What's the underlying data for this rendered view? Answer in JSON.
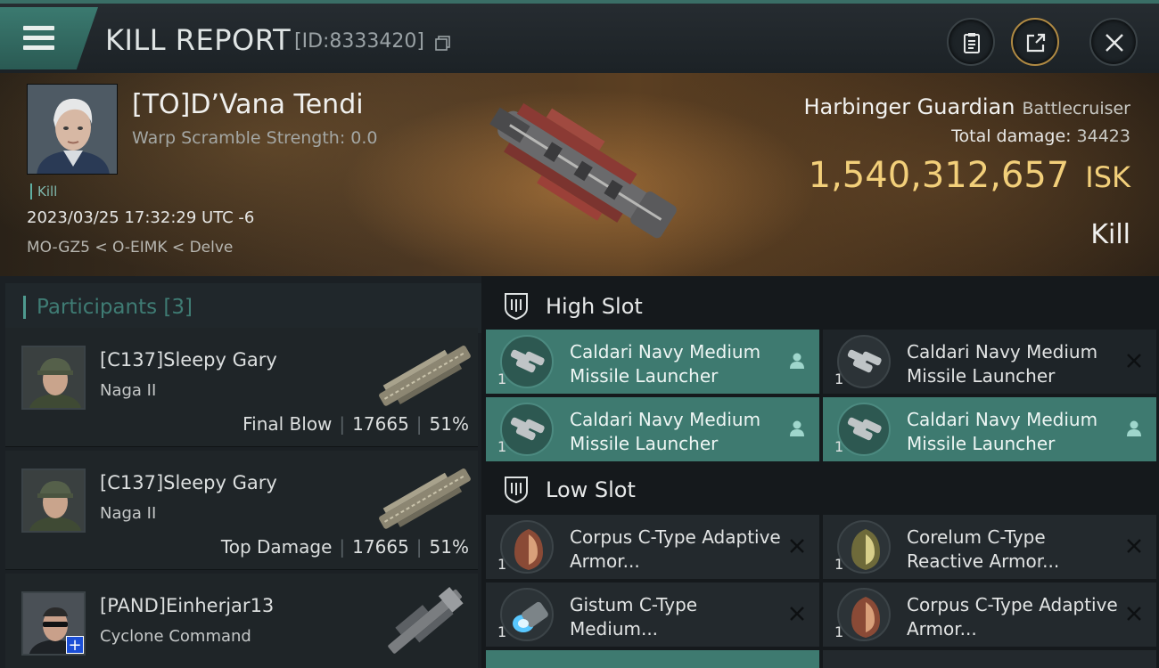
{
  "titlebar": {
    "title": "KILL REPORT",
    "id_label": "[ID:8333420]"
  },
  "victim": {
    "name": "[TO]D’Vana Tendi",
    "warp_scramble": "Warp Scramble Strength: 0.0",
    "tag": "Kill",
    "datetime": "2023/03/25 17:32:29 UTC -6",
    "location": "MO-GZ5 < O-EIMK < Delve",
    "ship_name": "Harbinger Guardian",
    "ship_class": "Battlecruiser",
    "damage_label": "Total damage:",
    "damage_value": "34423",
    "isk_value": "1,540,312,657",
    "isk_unit": "ISK",
    "result": "Kill"
  },
  "participants": {
    "header": "Participants [3]",
    "rows": [
      {
        "name": "[C137]Sleepy Gary",
        "ship": "Naga II",
        "role": "Final Blow",
        "damage": "17665",
        "percent": "51%"
      },
      {
        "name": "[C137]Sleepy Gary",
        "ship": "Naga II",
        "role": "Top Damage",
        "damage": "17665",
        "percent": "51%"
      },
      {
        "name": "[PAND]Einherjar13",
        "ship": "Cyclone Command",
        "role": "",
        "damage": "",
        "percent": ""
      }
    ]
  },
  "fitting": {
    "high_slot_label": "High Slot",
    "low_slot_label": "Low Slot",
    "high": [
      {
        "name": "Caldari Navy Medium Missile Launcher",
        "qty": "1",
        "status": "user-icon"
      },
      {
        "name": "Caldari Navy Medium Missile Launcher",
        "qty": "1",
        "status": "close-icon"
      },
      {
        "name": "Caldari Navy Medium Missile Launcher",
        "qty": "1",
        "status": "user-icon"
      },
      {
        "name": "Caldari Navy Medium Missile Launcher",
        "qty": "1",
        "status": "user-icon"
      }
    ],
    "low": [
      {
        "name": "Corpus C-Type Adaptive Armor...",
        "qty": "1",
        "status": "close-icon"
      },
      {
        "name": "Corelum C-Type Reactive Armor...",
        "qty": "1",
        "status": "close-icon"
      },
      {
        "name": "Gistum C-Type Medium...",
        "qty": "1",
        "status": "close-icon"
      },
      {
        "name": "Corpus C-Type Adaptive Armor...",
        "qty": "1",
        "status": "close-icon"
      }
    ]
  },
  "colors": {
    "accent_teal": "#3e7a70",
    "isk_gold": "#f2cf7a"
  }
}
